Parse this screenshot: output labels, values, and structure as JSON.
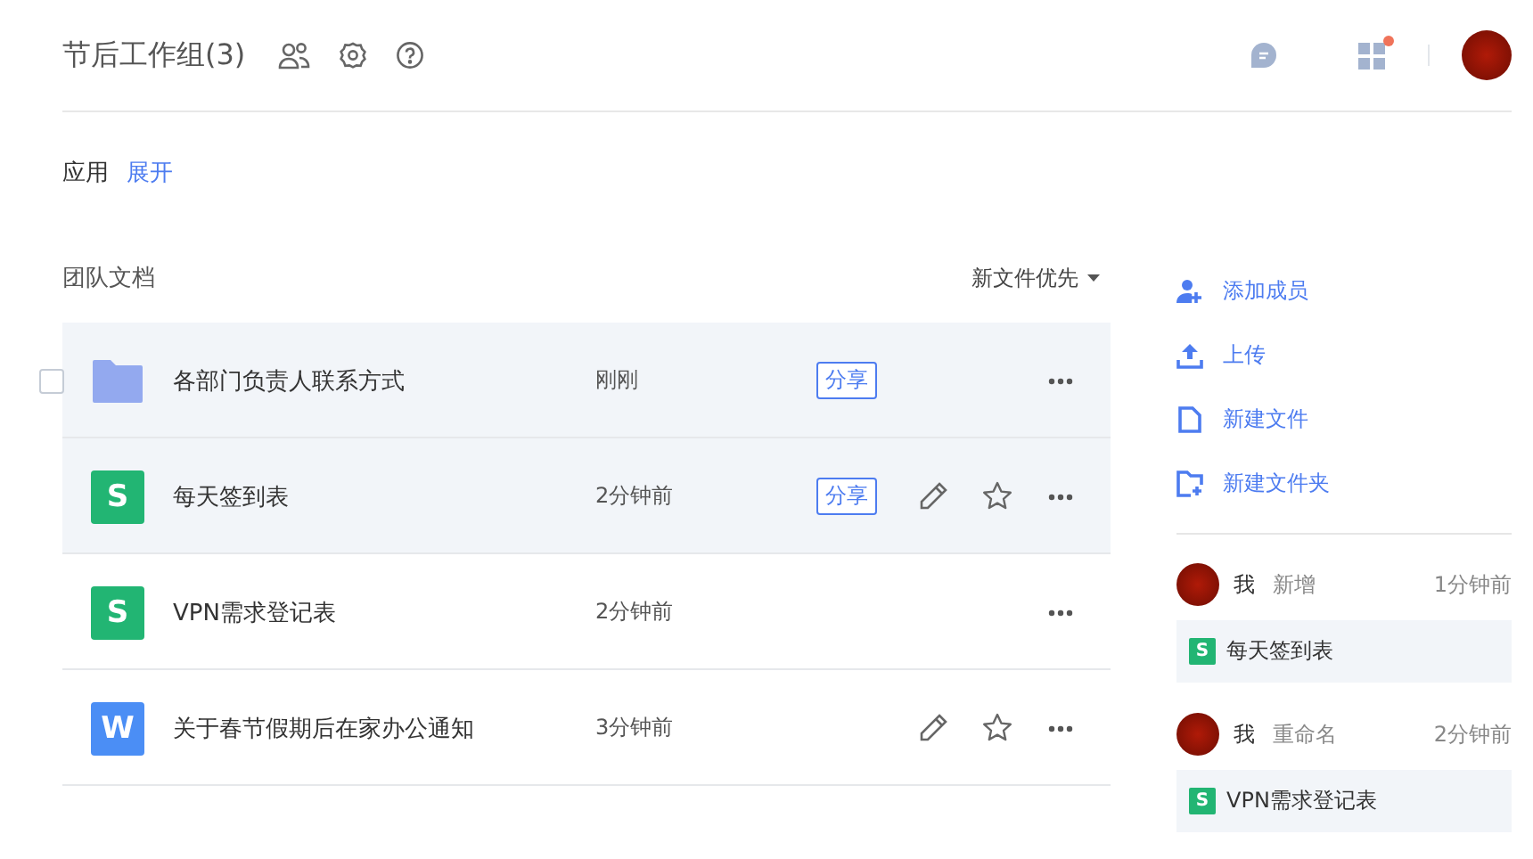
{
  "header": {
    "title": "节后工作组(3)",
    "notification_dot": true
  },
  "apps": {
    "label": "应用",
    "toggle": "展开"
  },
  "docs": {
    "title": "团队文档",
    "sort": "新文件优先",
    "rows": [
      {
        "kind": "folder",
        "name": "各部门负责人联系方式",
        "time": "刚刚",
        "highlighted": true,
        "hovered": true,
        "share": "分享",
        "editable": false,
        "starrable": false
      },
      {
        "kind": "sheet",
        "icon_letter": "S",
        "name": "每天签到表",
        "time": "2分钟前",
        "highlighted": true,
        "hovered": false,
        "share": "分享",
        "editable": true,
        "starrable": true
      },
      {
        "kind": "sheet",
        "icon_letter": "S",
        "name": "VPN需求登记表",
        "time": "2分钟前",
        "highlighted": false,
        "hovered": false,
        "editable": false,
        "starrable": false
      },
      {
        "kind": "doc",
        "icon_letter": "W",
        "name": "关于春节假期后在家办公通知",
        "time": "3分钟前",
        "highlighted": false,
        "hovered": false,
        "editable": true,
        "starrable": true
      }
    ]
  },
  "actions": [
    {
      "kind": "add-member",
      "label": "添加成员"
    },
    {
      "kind": "upload",
      "label": "上传"
    },
    {
      "kind": "new-file",
      "label": "新建文件"
    },
    {
      "kind": "new-folder",
      "label": "新建文件夹"
    }
  ],
  "activity": [
    {
      "user": "我",
      "action": "新增",
      "time": "1分钟前",
      "file": {
        "icon_letter": "S",
        "name": "每天签到表"
      }
    },
    {
      "user": "我",
      "action": "重命名",
      "time": "2分钟前",
      "file": {
        "icon_letter": "S",
        "name": "VPN需求登记表"
      }
    }
  ]
}
